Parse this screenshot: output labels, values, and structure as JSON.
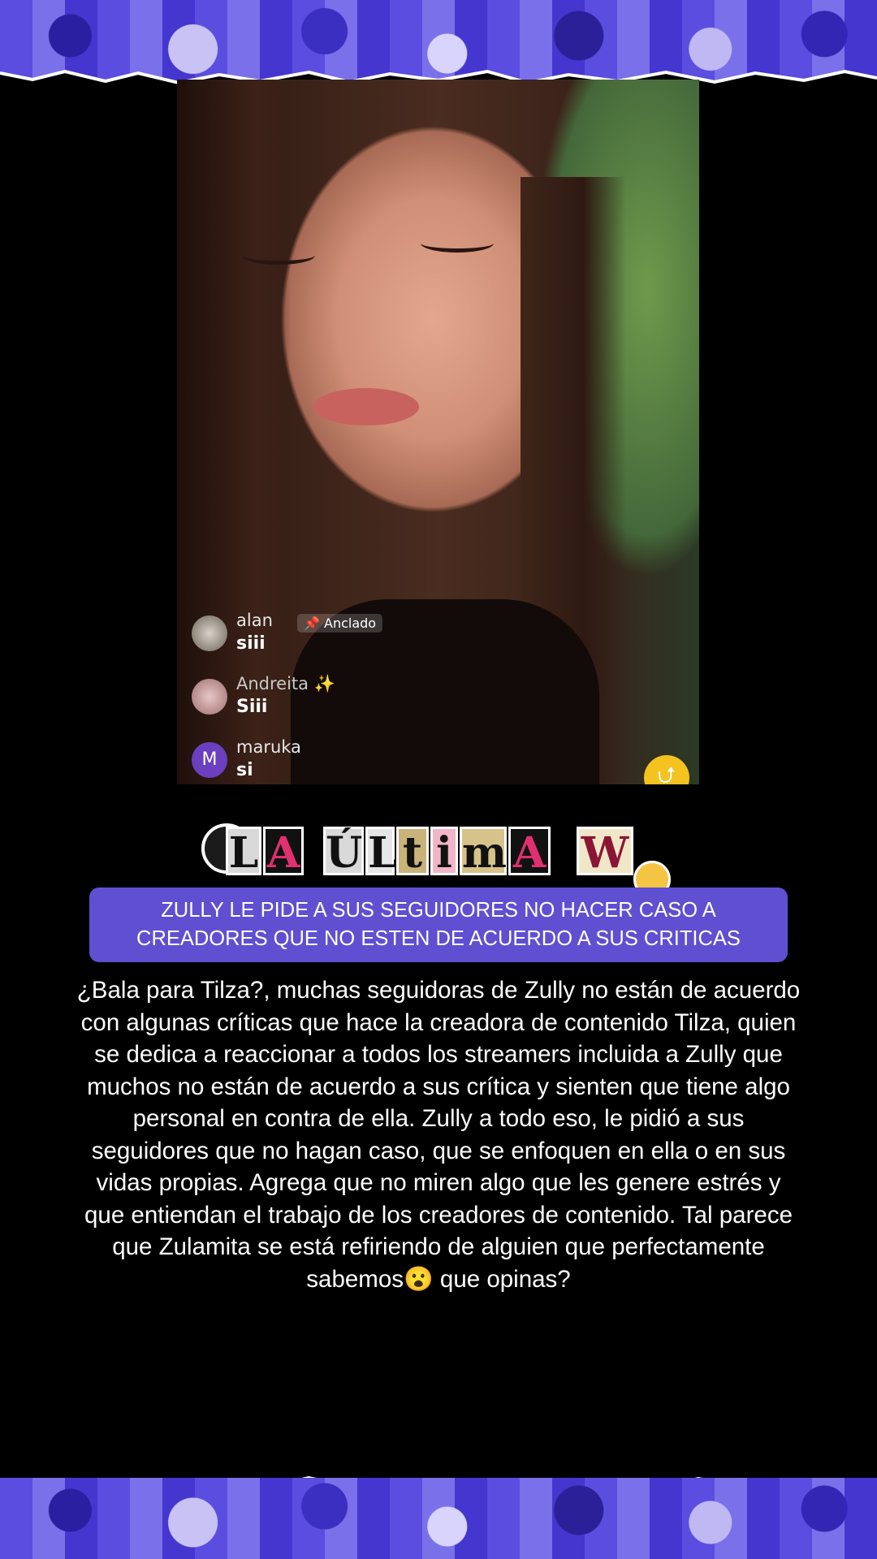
{
  "chat": {
    "comments": [
      {
        "user": "alan",
        "pinned_label": "📌 Anclado",
        "message": "siii"
      },
      {
        "user": "Andreita ✨",
        "message": "Siii"
      },
      {
        "user": "maruka",
        "avatar_letter": "M",
        "message": "si"
      }
    ]
  },
  "logo": {
    "tiles": [
      "L",
      "A",
      "Ú",
      "L",
      "t",
      "i",
      "m",
      "A",
      "W"
    ]
  },
  "headline": "ZULLY LE PIDE A SUS SEGUIDORES NO HACER CASO A CREADORES QUE NO ESTEN DE ACUERDO A SUS CRITICAS",
  "body": "¿Bala para Tilza?, muchas seguidoras de Zully no están de acuerdo con algunas críticas que hace la creadora de contenido Tilza, quien se dedica a reaccionar a todos los streamers incluida a Zully que muchos no están de acuerdo a sus crítica y sienten que tiene algo personal en contra de ella. Zully a todo eso, le pidió a sus seguidores que no hagan caso, que se enfoquen en ella o en sus vidas propias. Agrega que no miren algo que les genere estrés y que entiendan el trabajo de los creadores de contenido. Tal parece que Zulamita se está refiriendo de alguien que perfectamente sabemos😮 que opinas?",
  "colors": {
    "accent": "#5f4fd1",
    "collage": "#5a4de0",
    "share_button": "#f4c320"
  },
  "icons": [
    "bomb-icon",
    "pin-icon",
    "share-icon",
    "hushed-face-icon"
  ]
}
